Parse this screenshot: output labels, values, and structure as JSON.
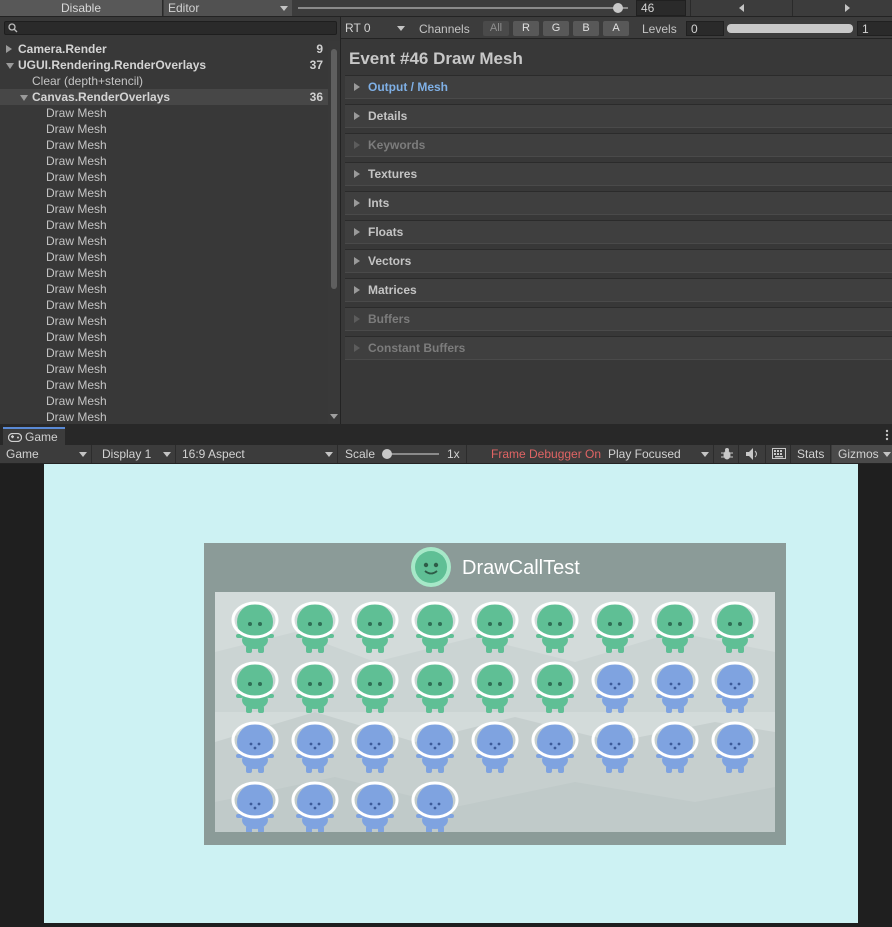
{
  "toolbar": {
    "disable_label": "Disable",
    "target": "Editor",
    "event_value": "46",
    "prev_icon": "arrow-left-icon",
    "next_icon": "arrow-right-icon",
    "event_fraction": 0.97
  },
  "hierarchy": {
    "search_placeholder": "",
    "rows": [
      {
        "label": "Camera.Render",
        "count": "9",
        "expanded": false
      },
      {
        "label": "UGUI.Rendering.RenderOverlays",
        "count": "37",
        "expanded": true
      },
      {
        "label": "Clear (depth+stencil)",
        "count": ""
      },
      {
        "label": "Canvas.RenderOverlays",
        "count": "36",
        "expanded": true,
        "selected": true
      },
      {
        "label": "Draw Mesh"
      },
      {
        "label": "Draw Mesh"
      },
      {
        "label": "Draw Mesh"
      },
      {
        "label": "Draw Mesh"
      },
      {
        "label": "Draw Mesh"
      },
      {
        "label": "Draw Mesh"
      },
      {
        "label": "Draw Mesh"
      },
      {
        "label": "Draw Mesh"
      },
      {
        "label": "Draw Mesh"
      },
      {
        "label": "Draw Mesh"
      },
      {
        "label": "Draw Mesh"
      },
      {
        "label": "Draw Mesh"
      },
      {
        "label": "Draw Mesh"
      },
      {
        "label": "Draw Mesh"
      },
      {
        "label": "Draw Mesh"
      },
      {
        "label": "Draw Mesh"
      },
      {
        "label": "Draw Mesh"
      },
      {
        "label": "Draw Mesh"
      },
      {
        "label": "Draw Mesh"
      },
      {
        "label": "Draw Mesh"
      }
    ]
  },
  "event_panel": {
    "rt_select": "RT 0",
    "channels_label": "Channels",
    "channels": [
      "All",
      "R",
      "G",
      "B",
      "A"
    ],
    "levels_label": "Levels",
    "levels_min": "0",
    "levels_max": "1",
    "title": "Event #46 Draw Mesh",
    "sections": [
      {
        "label": "Output / Mesh",
        "state": "link"
      },
      {
        "label": "Details",
        "state": "enabled"
      },
      {
        "label": "Keywords",
        "state": "disabled"
      },
      {
        "label": "Textures",
        "state": "enabled"
      },
      {
        "label": "Ints",
        "state": "enabled"
      },
      {
        "label": "Floats",
        "state": "enabled"
      },
      {
        "label": "Vectors",
        "state": "enabled"
      },
      {
        "label": "Matrices",
        "state": "enabled"
      },
      {
        "label": "Buffers",
        "state": "disabled"
      },
      {
        "label": "Constant Buffers",
        "state": "disabled"
      }
    ]
  },
  "game": {
    "tab_label": "Game",
    "tab_icon": "gamepad-icon",
    "menu_icon": "more-vertical-icon",
    "mode": "Game",
    "display": "Display 1",
    "aspect": "16:9 Aspect",
    "scale_label": "Scale",
    "scale_value": "1x",
    "frame_debugger": "Frame Debugger On",
    "play_mode": "Play Focused",
    "stats_label": "Stats",
    "gizmos_label": "Gizmos",
    "bug_icon": "bug-icon",
    "audio_icon": "speaker-icon",
    "keyboard_icon": "keyboard-icon",
    "colors": {
      "accent_red": "#e06464",
      "green_char": "#5fbf95",
      "blue_char": "#7fa3e0",
      "bg": "#cdf2f3"
    }
  },
  "scene": {
    "title": "DrawCallTest",
    "rows": [
      [
        "green",
        "green",
        "green",
        "green",
        "green",
        "green",
        "green",
        "green",
        "green"
      ],
      [
        "green",
        "green",
        "green",
        "green",
        "green",
        "green",
        "blue",
        "blue",
        "blue"
      ],
      [
        "blue",
        "blue",
        "blue",
        "blue",
        "blue",
        "blue",
        "blue",
        "blue",
        "blue"
      ],
      [
        "blue",
        "blue",
        "blue",
        "blue"
      ]
    ]
  }
}
